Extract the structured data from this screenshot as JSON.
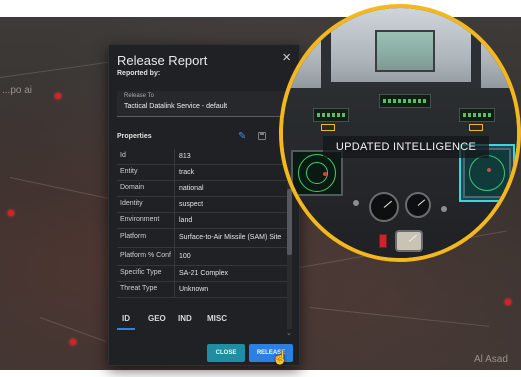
{
  "map": {
    "labels": {
      "left": "...po ai",
      "bottom_right": "Al Asad"
    }
  },
  "dialog": {
    "title": "Release Report",
    "close_glyph": "×",
    "reported_by_label": "Reported by:",
    "release_to": {
      "label": "Release To",
      "value": "Tactical Datalink Service - default"
    },
    "properties_label": "Properties",
    "properties": [
      {
        "key": "Id",
        "value": "813"
      },
      {
        "key": "Entity",
        "value": "track"
      },
      {
        "key": "Domain",
        "value": "national"
      },
      {
        "key": "Identity",
        "value": "suspect"
      },
      {
        "key": "Environment",
        "value": "land"
      },
      {
        "key": "Platform",
        "value": "Surface-to-Air Missile (SAM) Site"
      },
      {
        "key": "Platform % Conf",
        "value": "100"
      },
      {
        "key": "Specific Type",
        "value": "SA-21 Complex"
      },
      {
        "key": "Threat Type",
        "value": "Unknown"
      }
    ],
    "tabs": [
      {
        "label": "ID",
        "active": true
      },
      {
        "label": "GEO",
        "active": false
      },
      {
        "label": "IND",
        "active": false
      },
      {
        "label": "MISC",
        "active": false
      }
    ],
    "buttons": {
      "close": "CLOSE",
      "release": "RELEASE"
    }
  },
  "inset": {
    "banner": "UPDATED INTELLIGENCE"
  },
  "colors": {
    "accent_blue": "#2d7fe0",
    "close_teal": "#1f8ea3",
    "inset_border": "#f4b81e",
    "threat_red": "#d2232a"
  },
  "icons": [
    "pencil-icon",
    "save-icon",
    "close-icon",
    "chevron-down-icon",
    "pointer-cursor-icon"
  ]
}
